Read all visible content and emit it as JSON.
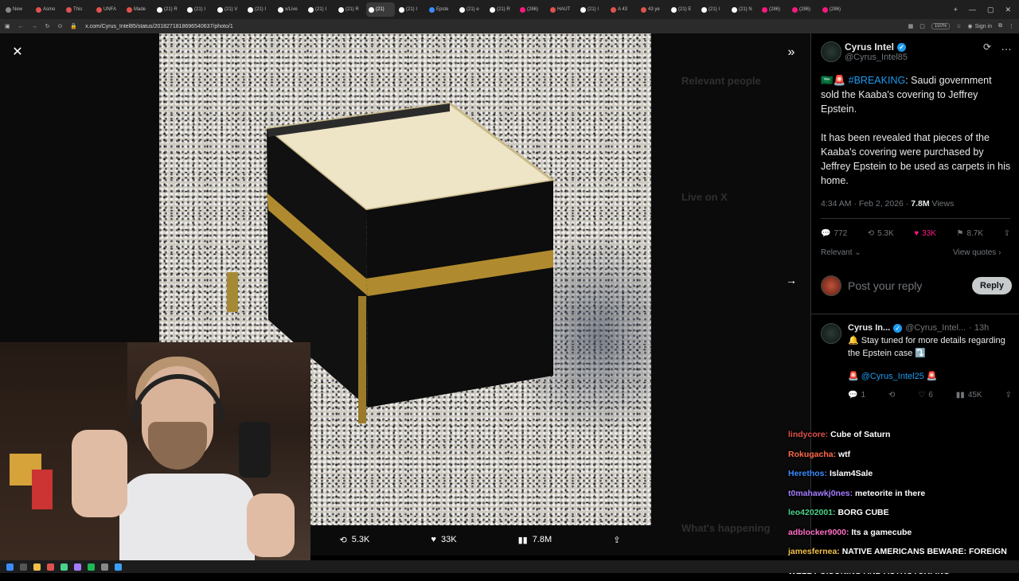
{
  "browser": {
    "tabs": [
      "New",
      "Asmo",
      "This",
      "UNFA",
      "Made",
      "(21) R",
      "(21) I",
      "(21) V",
      "(21) I",
      "x/Live",
      "(21) I",
      "(21) R",
      "(21)",
      "(21) I",
      "Epste",
      "(21) e",
      "(21) R",
      "(286)",
      "HAUT",
      "(21) I",
      "A 43",
      "43 ye",
      "(21) E",
      "(21) I",
      "(21) N",
      "(286)",
      "(286)",
      "(286)"
    ],
    "active_tab": "(21)",
    "url": "x.com/Cyrus_Intel85/status/2018271818696540637/photo/1",
    "zoom": "150%",
    "signin": "Sign in"
  },
  "viewer": {
    "close_icon": "close-icon",
    "expand_icon": "chevron-double-right-icon",
    "next_icon": "arrow-right-icon",
    "actions": {
      "retweets": "5.3K",
      "likes": "33K",
      "views": "7.8M"
    }
  },
  "background_ghost": {
    "relevant_people": "Relevant people",
    "live_on_x": "Live on X",
    "whats_happening": "What's happening"
  },
  "tweet": {
    "author_name": "Cyrus Intel",
    "author_handle": "@Cyrus_Intel85",
    "hashtag": "#BREAKING",
    "line1": ":  Saudi government sold the Kaaba's covering to Jeffrey Epstein.",
    "line2": "It has been revealed that pieces of the Kaaba's covering were purchased by Jeffrey Epstein to be used as carpets in his home.",
    "time": "4:34 AM · Feb 2, 2026 ·",
    "views_count": "7.8M",
    "views_label": "Views",
    "stats": {
      "replies": "772",
      "retweets": "5.3K",
      "likes": "33K",
      "bookmarks": "8.7K"
    },
    "relevant": "Relevant",
    "view_quotes": "View quotes",
    "reply_placeholder": "Post your reply",
    "reply_button": "Reply"
  },
  "reply1": {
    "name": "Cyrus In...",
    "handle": "@Cyrus_Intel...",
    "time": "· 13h",
    "text": "Stay tuned for more details regarding the Epstein case",
    "mention": "@Cyrus_Intel25",
    "stats": {
      "replies": "1",
      "likes": "6",
      "views": "45K"
    }
  },
  "chat": [
    {
      "user": "lindycore",
      "msg": "Cube of Saturn",
      "color": "c1"
    },
    {
      "user": "Rokugacha",
      "msg": "wtf",
      "color": "c2"
    },
    {
      "user": "Herethos",
      "msg": "Islam4Sale",
      "color": "c3"
    },
    {
      "user": "t0mahawkj0nes",
      "msg": "meteorite in there",
      "color": "c4"
    },
    {
      "user": "leo4202001",
      "msg": "BORG CUBE",
      "color": "c5"
    },
    {
      "user": "adblocker9000",
      "msg": "Its a gamecube",
      "color": "c6"
    },
    {
      "user": "jamesfernea",
      "msg": "NATIVE AMERICANS BEWARE: FOREIGN",
      "color": "c7"
    },
    {
      "user": "",
      "msg": "WELL POISONING AND ASTROTURFING",
      "color": "c7"
    }
  ]
}
